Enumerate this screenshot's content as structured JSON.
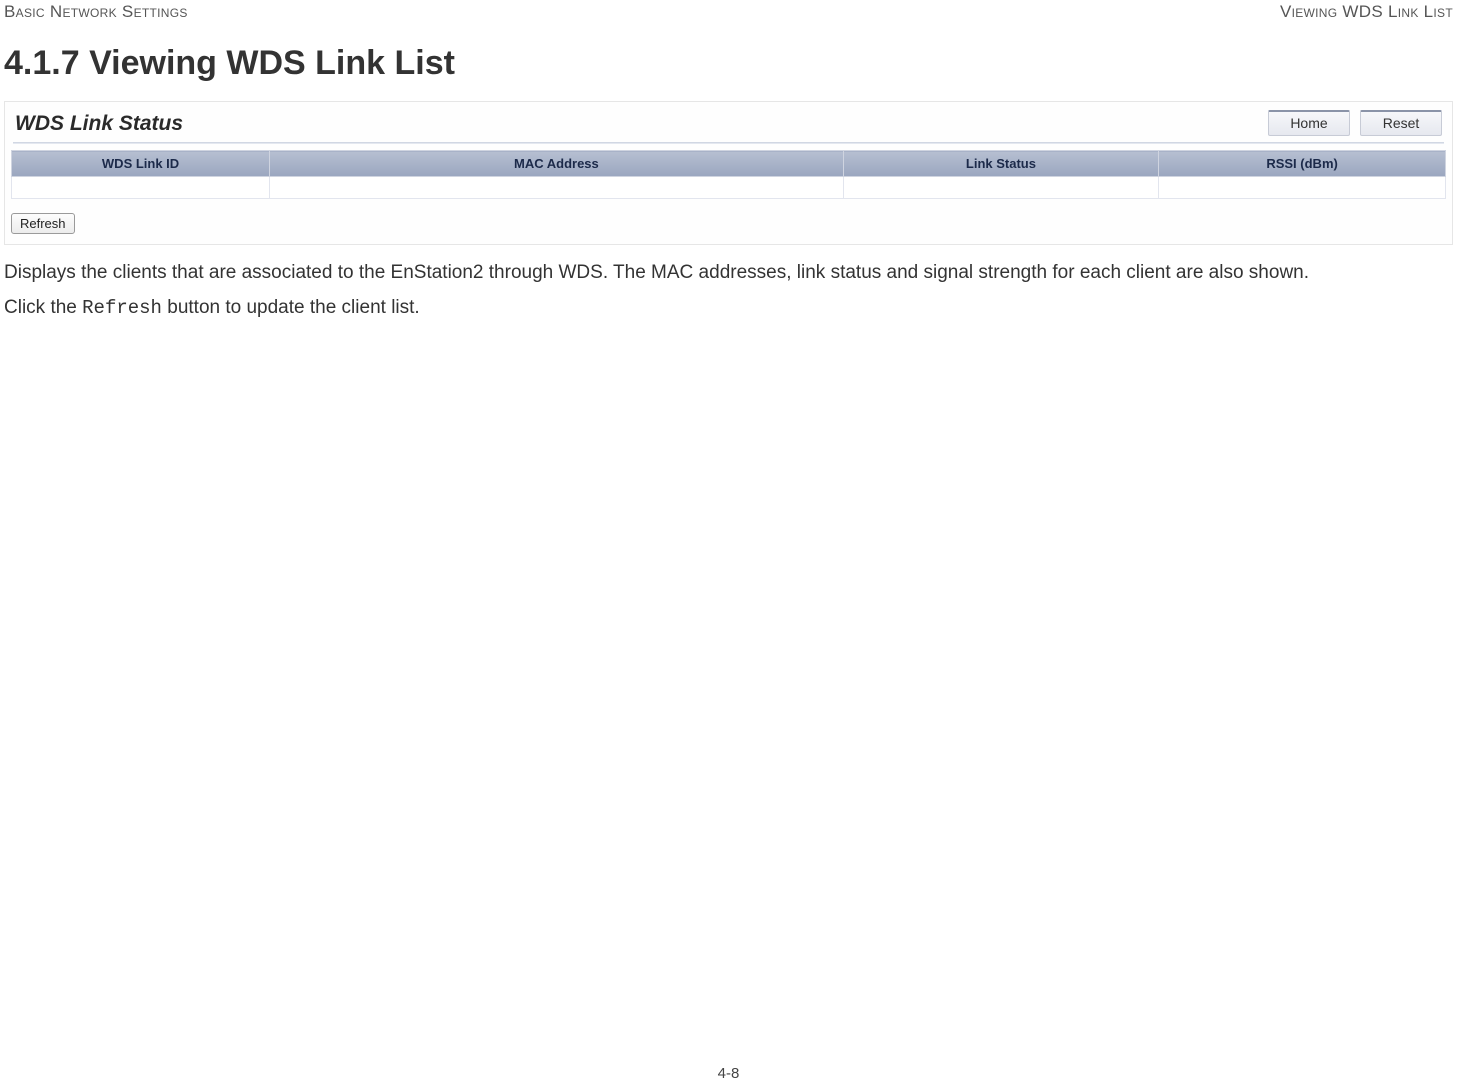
{
  "header": {
    "left": "Basic Network Settings",
    "right": "Viewing WDS Link List"
  },
  "section": {
    "number": "4.1.7",
    "title": "Viewing WDS Link List"
  },
  "panel": {
    "title": "WDS Link Status",
    "tabs": {
      "home": "Home",
      "reset": "Reset"
    },
    "columns": {
      "col1": "WDS Link ID",
      "col2": "MAC Address",
      "col3": "Link Status",
      "col4": "RSSI (dBm)"
    },
    "refresh": "Refresh"
  },
  "body": {
    "p1": "Displays the clients that are associated to the EnStation2 through WDS. The MAC addresses, link status and signal strength for each client are also shown.",
    "p2_prefix": "Click the ",
    "p2_code": "Refresh",
    "p2_suffix": " button to update the client list."
  },
  "footer": {
    "page": "4-8"
  }
}
